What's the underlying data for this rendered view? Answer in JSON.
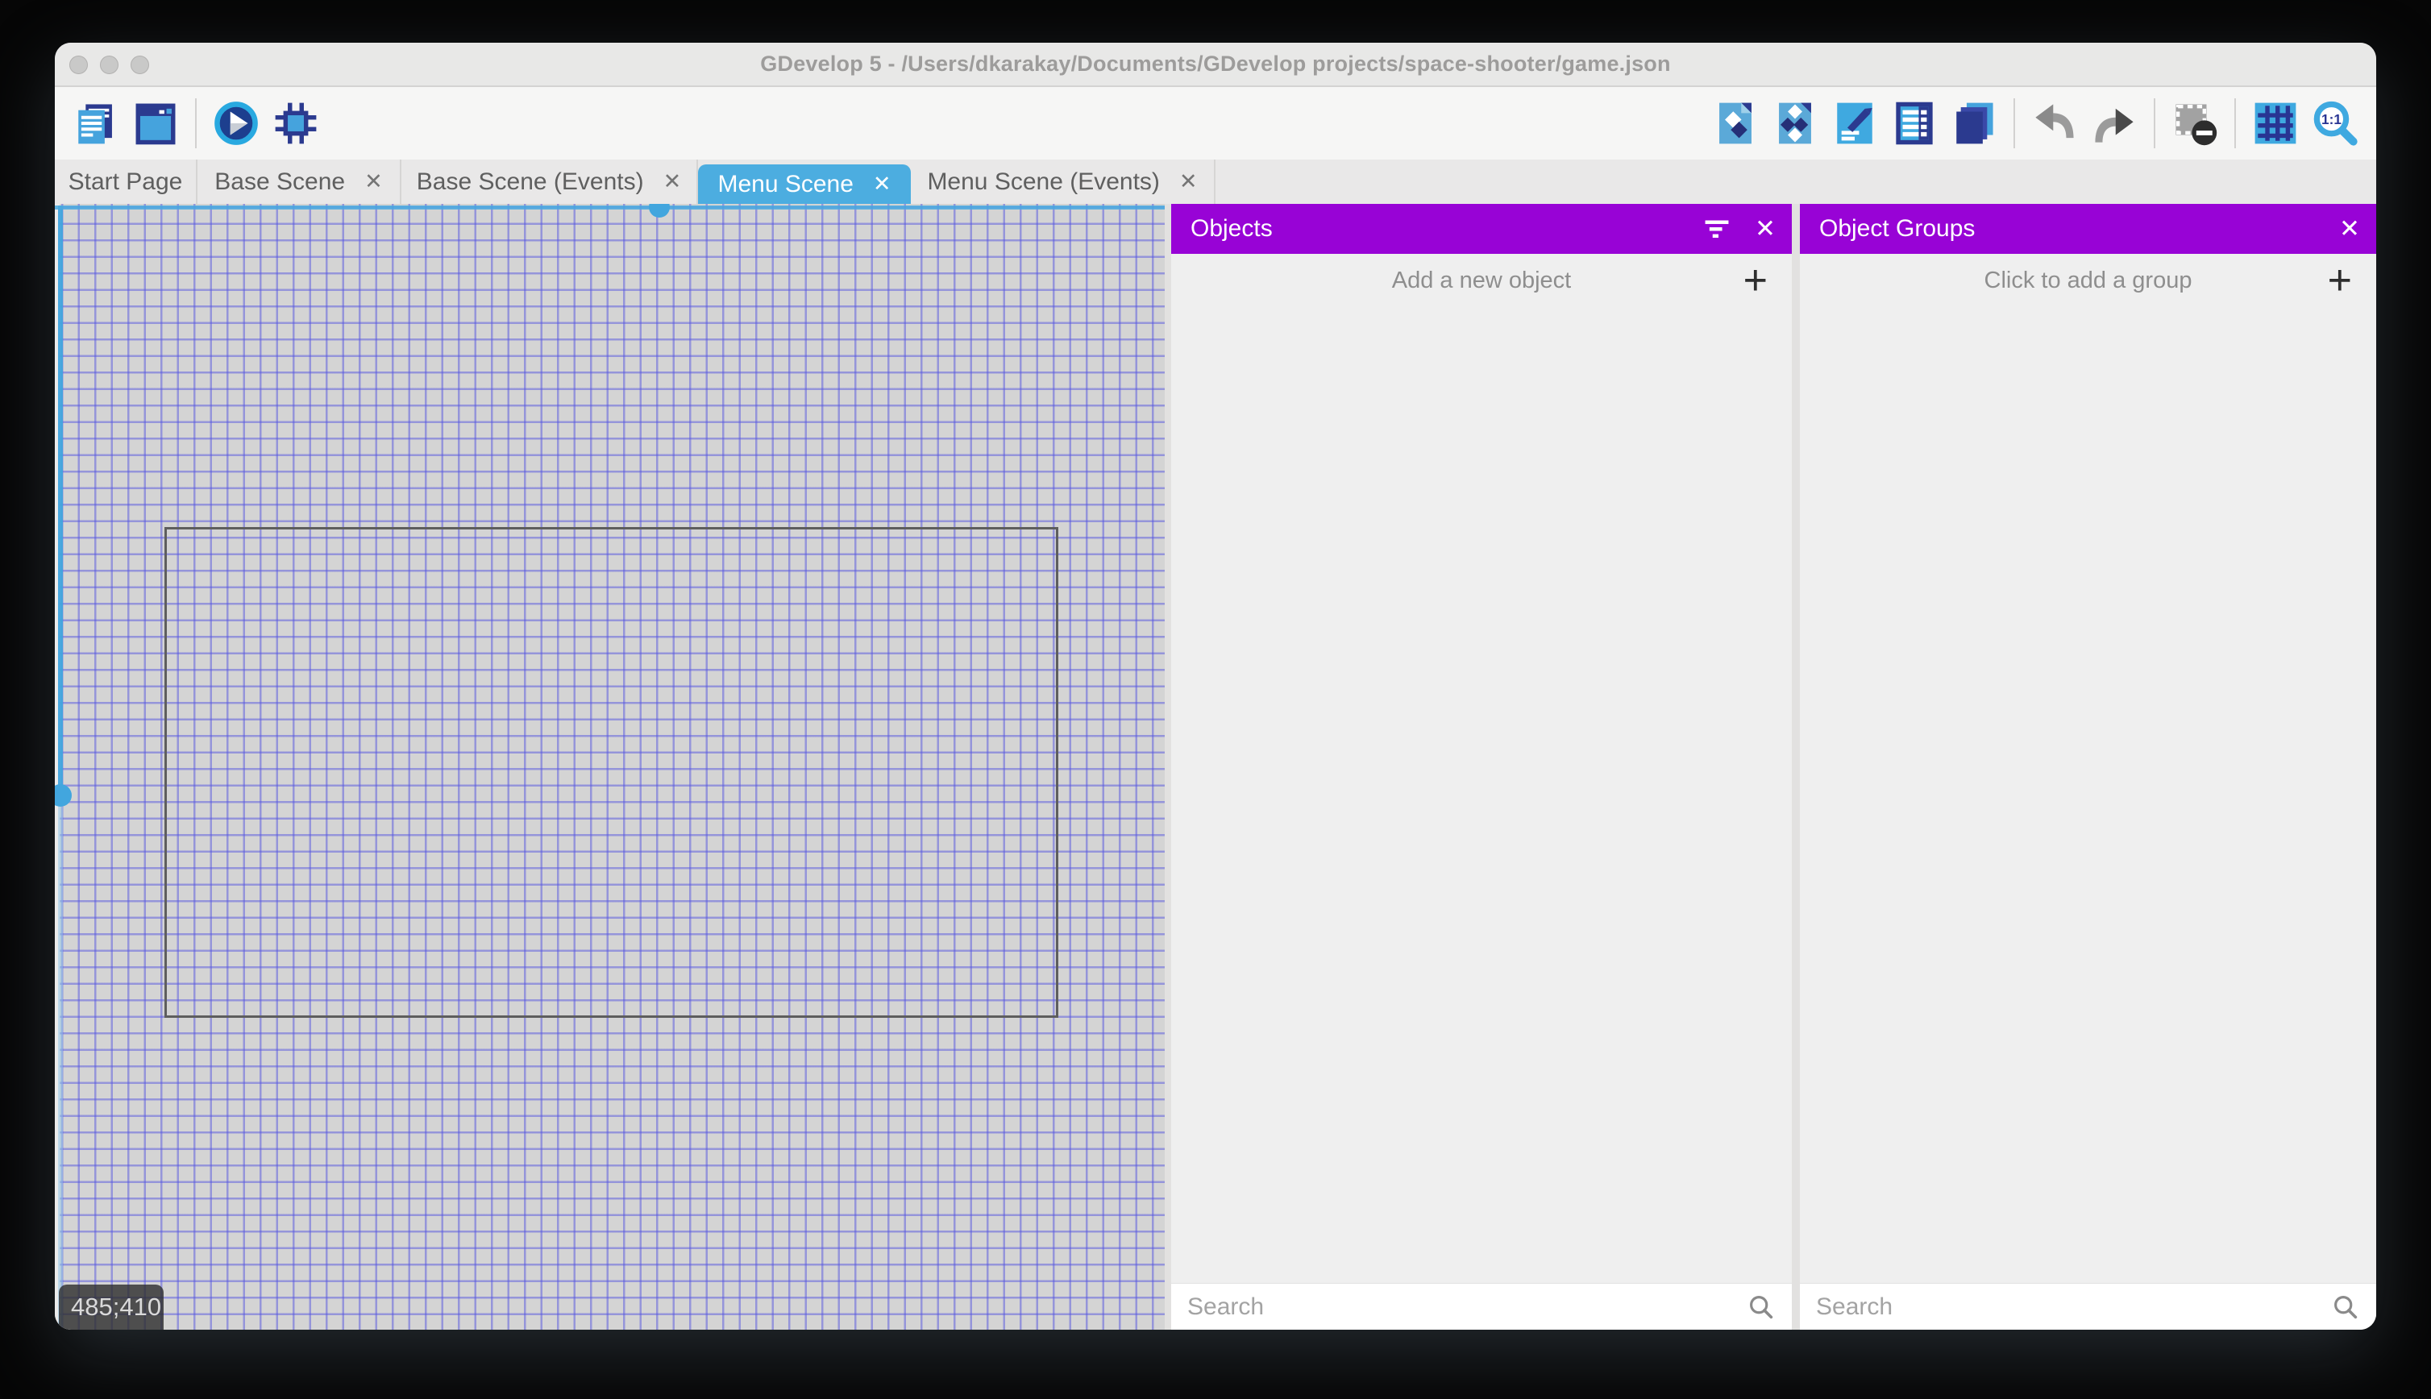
{
  "window": {
    "title": "GDevelop 5 - /Users/dkarakay/Documents/GDevelop projects/space-shooter/game.json"
  },
  "toolbar": {
    "left_icons": [
      "project-manager",
      "scene-editor",
      "preview-play",
      "debug"
    ],
    "right_icons": [
      "objects-editor",
      "object-groups-editor",
      "properties",
      "instances-list",
      "layers-editor",
      "undo",
      "redo",
      "window-mask-toggle",
      "grid-toggle",
      "zoom-one-to-one"
    ],
    "zoom_icon_label": "1:1"
  },
  "tabs": [
    {
      "label": "Start Page",
      "closable": false,
      "active": false
    },
    {
      "label": "Base Scene",
      "closable": true,
      "active": false
    },
    {
      "label": "Base Scene (Events)",
      "closable": true,
      "active": false
    },
    {
      "label": "Menu Scene",
      "closable": true,
      "active": true
    },
    {
      "label": "Menu Scene (Events)",
      "closable": true,
      "active": false
    }
  ],
  "glyphs": {
    "close": "✕",
    "plus": "+"
  },
  "canvas": {
    "coordinates_label": "485;410",
    "grid_color": "#5656e0",
    "selection_color": "#42a6de"
  },
  "panels": {
    "objects": {
      "title": "Objects",
      "add_label": "Add a new object",
      "search_placeholder": "Search"
    },
    "object_groups": {
      "title": "Object Groups",
      "add_label": "Click to add a group",
      "search_placeholder": "Search"
    }
  },
  "colors": {
    "accent_purple": "#9803d6",
    "active_tab_blue": "#4cade0",
    "icon_navy": "#2b3a8f",
    "icon_blue": "#3fa9e0"
  }
}
